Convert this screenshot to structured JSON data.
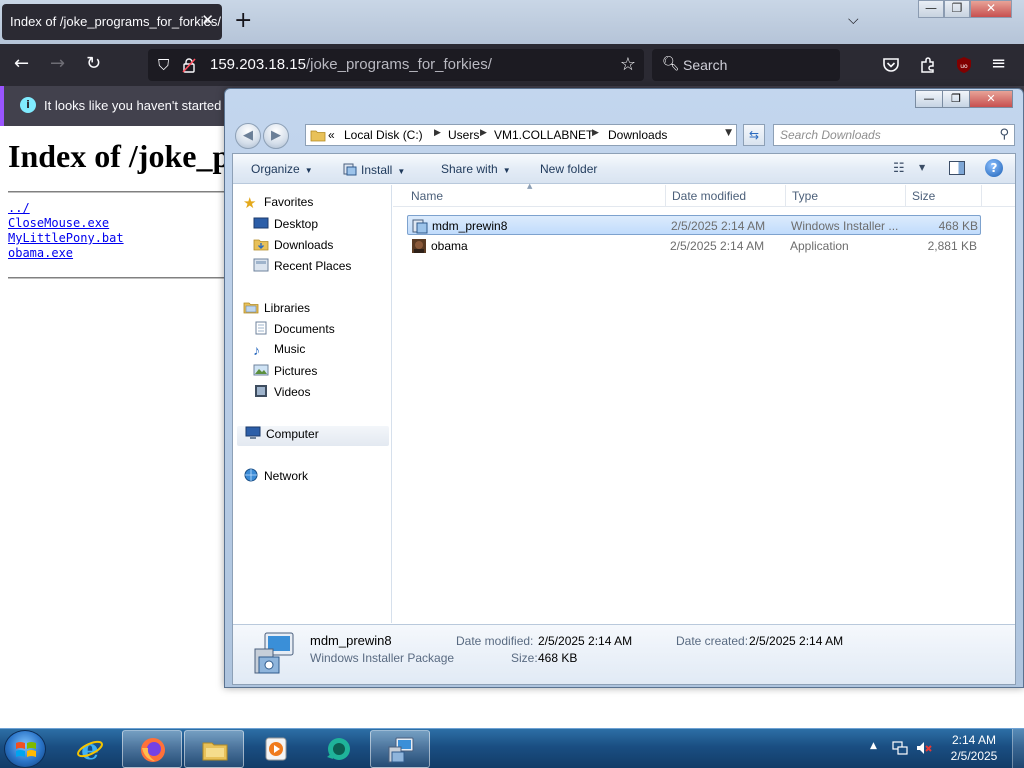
{
  "browser": {
    "tab_title": "Index of /joke_programs_for_forkies/",
    "tab_close": "✕",
    "new_tab": "+",
    "url_host": "159.203.18.15",
    "url_path": "/joke_programs_for_forkies/",
    "search_placeholder": "Search",
    "notice": "It looks like you haven't started Firefox in a while. Do you want to clean it up for a fresh, like-new experience? And by the way, welcome back!",
    "window_controls": {
      "minimize": "—",
      "maximize": "❐",
      "close": "✕"
    }
  },
  "page": {
    "heading": "Index of /joke_programs_for_forkies/",
    "links": [
      "../",
      "CloseMouse.exe",
      "MyLittlePony.bat",
      "obama.exe"
    ]
  },
  "explorer": {
    "window_controls": {
      "minimize": "—",
      "maximize": "❐",
      "close": "✕"
    },
    "breadcrumb": {
      "overflow": "«",
      "parts": [
        "Local Disk (C:)",
        "Users",
        "VM1.COLLABNET",
        "Downloads"
      ]
    },
    "search_placeholder": "Search Downloads",
    "toolbar": {
      "organize": "Organize",
      "install": "Install",
      "share_with": "Share with",
      "new_folder": "New folder"
    },
    "nav": {
      "favorites": {
        "label": "Favorites",
        "items": [
          "Desktop",
          "Downloads",
          "Recent Places"
        ]
      },
      "libraries": {
        "label": "Libraries",
        "items": [
          "Documents",
          "Music",
          "Pictures",
          "Videos"
        ]
      },
      "computer": "Computer",
      "network": "Network"
    },
    "columns": [
      "Name",
      "Date modified",
      "Type",
      "Size"
    ],
    "files": [
      {
        "name": "mdm_prewin8",
        "date": "2/5/2025 2:14 AM",
        "type": "Windows Installer ...",
        "size": "468 KB",
        "selected": true,
        "icon": "installer-icon"
      },
      {
        "name": "obama",
        "date": "2/5/2025 2:14 AM",
        "type": "Application",
        "size": "2,881 KB",
        "selected": false,
        "icon": "obama-app-icon"
      }
    ],
    "details": {
      "name": "mdm_prewin8",
      "type": "Windows Installer Package",
      "date_modified_label": "Date modified:",
      "date_modified": "2/5/2025 2:14 AM",
      "date_created_label": "Date created:",
      "date_created": "2/5/2025 2:14 AM",
      "size_label": "Size:",
      "size": "468 KB"
    }
  },
  "taskbar": {
    "time": "2:14 AM",
    "date": "2/5/2025",
    "apps": [
      "internet-explorer-icon",
      "firefox-icon",
      "file-explorer-icon",
      "media-player-icon",
      "chat-icon",
      "installer-icon"
    ]
  },
  "colors": {
    "firefox_dark": "#2b2a33",
    "explorer_selection": "#c1dcfc",
    "link_blue": "#0000ee",
    "taskbar_blue": "#1a4e82"
  }
}
